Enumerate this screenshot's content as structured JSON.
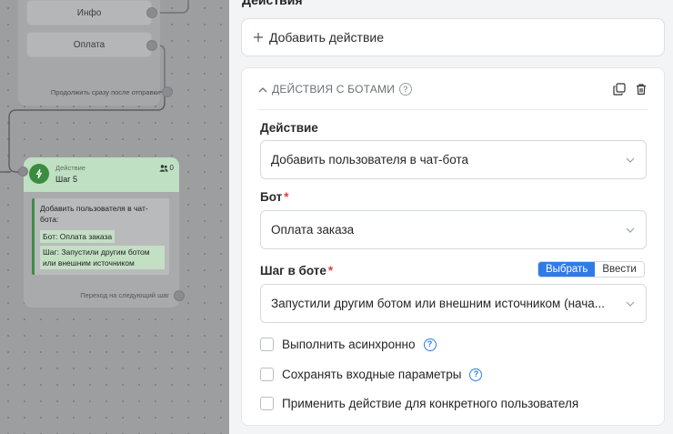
{
  "canvas": {
    "prev_node": {
      "buttons": [
        "Инфо",
        "Оплата"
      ],
      "continue_note": "Продолжить сразу после отправки"
    },
    "step_node": {
      "kind": "Действие",
      "name": "Шаг 5",
      "users_count": "0",
      "body_title": "Добавить пользователя в чат-бота:",
      "bot_line": "Бот: Оплата заказа",
      "step_line": "Шаг: Запустили другим ботом или внешним источником",
      "footer": "Переход на следующий шаг",
      "accent_color": "#3a8c3f"
    }
  },
  "panel": {
    "section_title": "Действия",
    "add_action_label": "Добавить действие",
    "card": {
      "header": "ДЕЙСТВИЯ С БОТАМИ",
      "fields": {
        "action": {
          "label": "Действие",
          "value": "Добавить пользователя в чат-бота"
        },
        "bot": {
          "label": "Бот",
          "value": "Оплата заказа"
        },
        "step": {
          "label": "Шаг в боте",
          "value": "Запустили другим ботом или внешним источником (нача...",
          "modes": [
            "Выбрать",
            "Ввести"
          ],
          "active_mode": "Выбрать"
        }
      },
      "options": [
        {
          "label": "Выполнить асинхронно",
          "checked": false,
          "help": true
        },
        {
          "label": "Сохранять входные параметры",
          "checked": false,
          "help": true
        },
        {
          "label": "Применить действие для конкретного пользователя",
          "checked": false,
          "help": false
        }
      ]
    },
    "accent_color": "#2f7be8",
    "required_color": "#e23b3b"
  }
}
